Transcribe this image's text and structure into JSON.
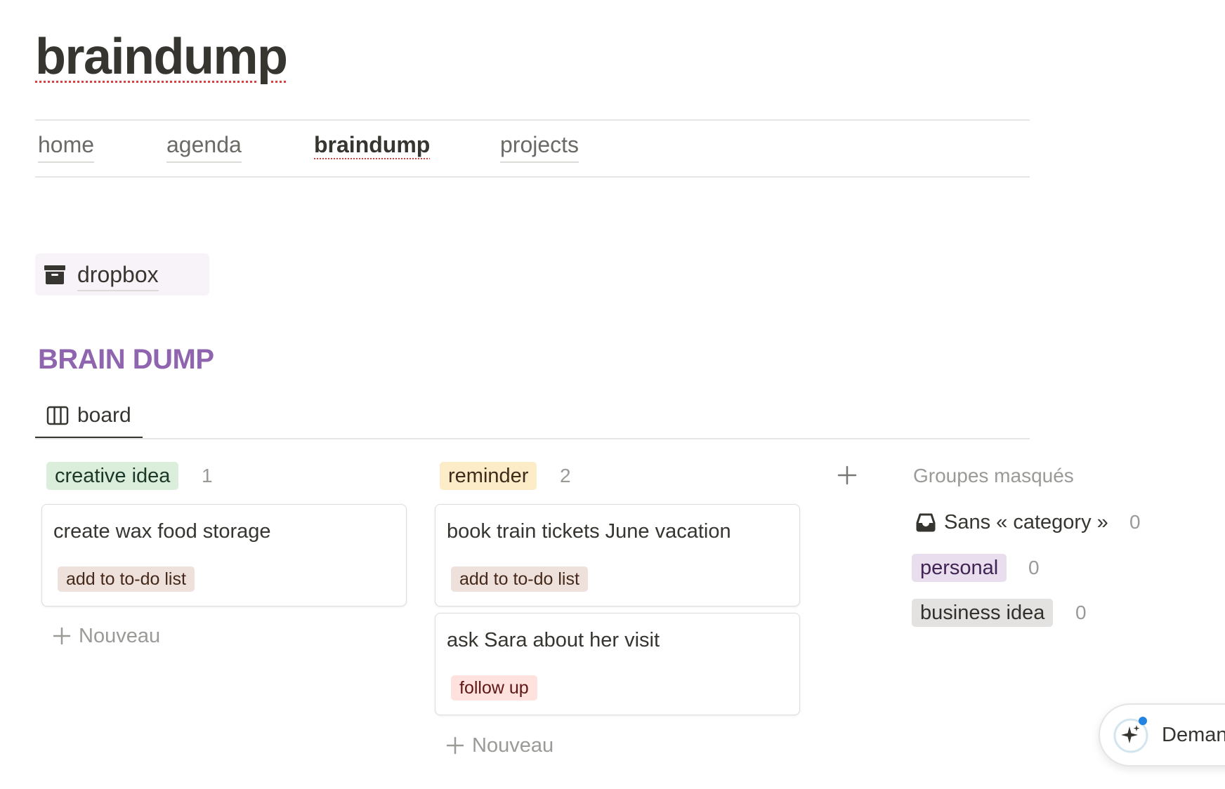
{
  "page": {
    "title": "braindump"
  },
  "nav": {
    "items": [
      {
        "label": "home"
      },
      {
        "label": "agenda"
      },
      {
        "label": "braindump",
        "active": true
      },
      {
        "label": "projects"
      }
    ]
  },
  "dropbox": {
    "icon": "archive-box-icon",
    "label": "dropbox"
  },
  "database": {
    "title": "BRAIN DUMP",
    "title_color": "#9065b0",
    "view_tab": {
      "icon": "board-columns-icon",
      "label": "board"
    },
    "groups": [
      {
        "label": "creative idea",
        "color_bg": "#dbeddb",
        "color_text": "#1c3829",
        "count": "1",
        "cards": [
          {
            "title": "create wax food storage",
            "tag": "add to to-do list",
            "tag_bg": "#eee0da",
            "tag_text": "#44291a"
          }
        ],
        "new_label": "Nouveau"
      },
      {
        "label": "reminder",
        "color_bg": "#fdecc8",
        "color_text": "#402c1b",
        "count": "2",
        "cards": [
          {
            "title": "book train tickets June vacation",
            "tag": "add to to-do list",
            "tag_bg": "#eee0da",
            "tag_text": "#44291a"
          },
          {
            "title": "ask Sara about her visit",
            "tag": "follow up",
            "tag_bg": "#ffe2dd",
            "tag_text": "#5d1715"
          }
        ],
        "new_label": "Nouveau"
      }
    ],
    "add_group_icon": "plus-icon",
    "hidden_groups": {
      "title": "Groupes masqués",
      "items": [
        {
          "label": "Sans « category »",
          "count": "0",
          "icon": "inbox-tray-icon"
        },
        {
          "label": "personal",
          "count": "0",
          "color_bg": "#e8deee",
          "color_text": "#412454"
        },
        {
          "label": "business idea",
          "count": "0",
          "color_bg": "#e3e2e0",
          "color_text": "#32302c"
        }
      ]
    }
  },
  "ask_button": {
    "icon": "ai-sparkle-icon",
    "label": "Deman"
  }
}
